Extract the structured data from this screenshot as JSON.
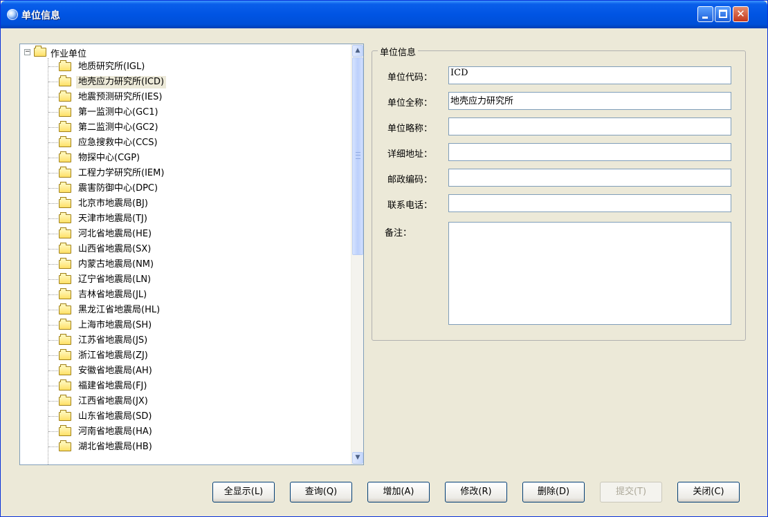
{
  "window": {
    "title": "单位信息"
  },
  "tree": {
    "root_label": "作业单位",
    "root_expander": "−",
    "items": [
      {
        "label": "地质研究所(IGL)"
      },
      {
        "label": "地壳应力研究所(ICD)",
        "selected": true
      },
      {
        "label": "地震预测研究所(IES)"
      },
      {
        "label": "第一监测中心(GC1)"
      },
      {
        "label": "第二监测中心(GC2)"
      },
      {
        "label": "应急搜救中心(CCS)"
      },
      {
        "label": "物探中心(CGP)"
      },
      {
        "label": "工程力学研究所(IEM)"
      },
      {
        "label": "震害防御中心(DPC)"
      },
      {
        "label": "北京市地震局(BJ)"
      },
      {
        "label": "天津市地震局(TJ)"
      },
      {
        "label": "河北省地震局(HE)"
      },
      {
        "label": "山西省地震局(SX)"
      },
      {
        "label": "内蒙古地震局(NM)"
      },
      {
        "label": "辽宁省地震局(LN)"
      },
      {
        "label": "吉林省地震局(JL)"
      },
      {
        "label": "黑龙江省地震局(HL)"
      },
      {
        "label": "上海市地震局(SH)"
      },
      {
        "label": "江苏省地震局(JS)"
      },
      {
        "label": "浙江省地震局(ZJ)"
      },
      {
        "label": "安徽省地震局(AH)"
      },
      {
        "label": "福建省地震局(FJ)"
      },
      {
        "label": "江西省地震局(JX)"
      },
      {
        "label": "山东省地震局(SD)"
      },
      {
        "label": "河南省地震局(HA)"
      },
      {
        "label": "湖北省地震局(HB)"
      }
    ]
  },
  "form": {
    "group_title": "单位信息",
    "code_label": "单位代码：",
    "code_value": "ICD",
    "fullname_label": "单位全称：",
    "fullname_value": "地壳应力研究所",
    "shortname_label": "单位略称：",
    "shortname_value": "",
    "address_label": "详细地址：",
    "address_value": "",
    "postcode_label": "邮政编码：",
    "postcode_value": "",
    "phone_label": "联系电话：",
    "phone_value": "",
    "remark_label": "备注：",
    "remark_value": ""
  },
  "buttons": {
    "show_all": "全显示(L)",
    "query": "查询(Q)",
    "add": "增加(A)",
    "modify": "修改(R)",
    "delete": "删除(D)",
    "submit": "提交(T)",
    "close": "关闭(C)"
  }
}
